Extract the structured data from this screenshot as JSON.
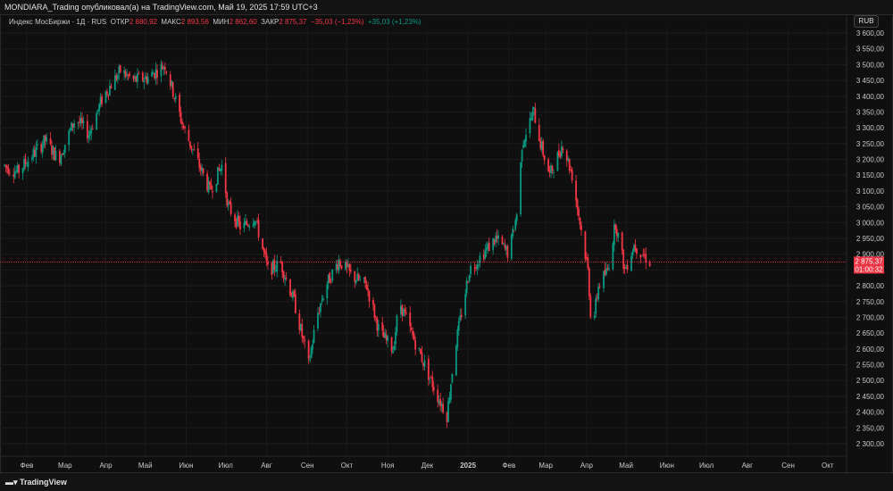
{
  "header": {
    "title": "MONDIARA_Trading опубликовал(а) на TradingView.com, Май 19, 2025 17:59 UTC+3"
  },
  "legend": {
    "symbol": "Индекс МосБиржи · 1Д · RUS",
    "open_label": "ОТКР",
    "open": "2 880,92",
    "high_label": "МАКС",
    "high": "2 893,56",
    "low_label": "МИН",
    "low": "2 862,60",
    "close_label": "ЗАКР",
    "close": "2 875,37",
    "change": "−35,03 (−1,23%)",
    "change2": "+35,03 (+1,23%)"
  },
  "currency": "RUB",
  "price_tag": {
    "price": "2 875,37",
    "countdown": "01:00:32"
  },
  "footer": {
    "brand": "TradingView"
  },
  "colors": {
    "up": "#089981",
    "down": "#f23645",
    "background": "#0f0f0f"
  },
  "chart_data": {
    "type": "candlestick",
    "title": "Индекс МосБиржи · 1Д",
    "ylim": [
      2280,
      3630
    ],
    "y_ticks": [
      3600,
      3550,
      3500,
      3450,
      3400,
      3350,
      3300,
      3250,
      3200,
      3150,
      3100,
      3050,
      3000,
      2950,
      2900,
      2850,
      2800,
      2750,
      2700,
      2650,
      2600,
      2550,
      2500,
      2450,
      2400,
      2350,
      2300
    ],
    "y_tick_labels": [
      "3 600,00",
      "3 550,00",
      "3 500,00",
      "3 450,00",
      "3 400,00",
      "3 350,00",
      "3 300,00",
      "3 250,00",
      "3 200,00",
      "3 150,00",
      "3 100,00",
      "3 050,00",
      "3 000,00",
      "2 950,00",
      "2 900,00",
      "2 850,00",
      "2 800,00",
      "2 750,00",
      "2 700,00",
      "2 650,00",
      "2 600,00",
      "2 550,00",
      "2 500,00",
      "2 450,00",
      "2 400,00",
      "2 350,00",
      "2 300,00"
    ],
    "x_ticks": [
      {
        "date": "2024-02-01",
        "label": "Фев"
      },
      {
        "date": "2024-03-01",
        "label": "Мар"
      },
      {
        "date": "2024-04-01",
        "label": "Апр"
      },
      {
        "date": "2024-05-01",
        "label": "Май"
      },
      {
        "date": "2024-06-01",
        "label": "Июн"
      },
      {
        "date": "2024-07-01",
        "label": "Июл"
      },
      {
        "date": "2024-08-01",
        "label": "Авг"
      },
      {
        "date": "2024-09-01",
        "label": "Сен"
      },
      {
        "date": "2024-10-01",
        "label": "Окт"
      },
      {
        "date": "2024-11-01",
        "label": "Ноя"
      },
      {
        "date": "2024-12-01",
        "label": "Дек"
      },
      {
        "date": "2025-01-01",
        "label": "2025"
      },
      {
        "date": "2025-02-01",
        "label": "Фев"
      },
      {
        "date": "2025-03-01",
        "label": "Мар"
      },
      {
        "date": "2025-04-01",
        "label": "Апр"
      },
      {
        "date": "2025-05-01",
        "label": "Май"
      },
      {
        "date": "2025-06-01",
        "label": "Июн"
      },
      {
        "date": "2025-07-01",
        "label": "Июл"
      },
      {
        "date": "2025-08-01",
        "label": "Авг"
      },
      {
        "date": "2025-09-01",
        "label": "Сен"
      },
      {
        "date": "2025-10-01",
        "label": "Окт"
      }
    ],
    "approx_closes": [
      [
        "2024-01-15",
        3180
      ],
      [
        "2024-01-25",
        3160
      ],
      [
        "2024-02-15",
        3260
      ],
      [
        "2024-02-25",
        3200
      ],
      [
        "2024-03-09",
        3330
      ],
      [
        "2024-03-19",
        3280
      ],
      [
        "2024-03-30",
        3400
      ],
      [
        "2024-04-12",
        3480
      ],
      [
        "2024-04-22",
        3450
      ],
      [
        "2024-05-03",
        3460
      ],
      [
        "2024-05-16",
        3500
      ],
      [
        "2024-05-23",
        3400
      ],
      [
        "2024-05-30",
        3300
      ],
      [
        "2024-06-09",
        3200
      ],
      [
        "2024-06-19",
        3100
      ],
      [
        "2024-06-28",
        3180
      ],
      [
        "2024-07-03",
        3050
      ],
      [
        "2024-07-13",
        2980
      ],
      [
        "2024-07-23",
        3020
      ],
      [
        "2024-08-02",
        2850
      ],
      [
        "2024-08-12",
        2870
      ],
      [
        "2024-08-22",
        2750
      ],
      [
        "2024-09-02",
        2550
      ],
      [
        "2024-09-08",
        2700
      ],
      [
        "2024-09-15",
        2800
      ],
      [
        "2024-09-25",
        2880
      ],
      [
        "2024-10-05",
        2830
      ],
      [
        "2024-10-16",
        2800
      ],
      [
        "2024-10-26",
        2650
      ],
      [
        "2024-11-05",
        2600
      ],
      [
        "2024-11-10",
        2750
      ],
      [
        "2024-11-19",
        2650
      ],
      [
        "2024-11-29",
        2550
      ],
      [
        "2024-12-09",
        2450
      ],
      [
        "2024-12-16",
        2390
      ],
      [
        "2024-12-22",
        2600
      ],
      [
        "2025-01-02",
        2850
      ],
      [
        "2025-01-12",
        2900
      ],
      [
        "2025-01-22",
        2950
      ],
      [
        "2025-02-01",
        2900
      ],
      [
        "2025-02-08",
        3050
      ],
      [
        "2025-02-11",
        3250
      ],
      [
        "2025-02-15",
        3300
      ],
      [
        "2025-02-20",
        3350
      ],
      [
        "2025-02-25",
        3250
      ],
      [
        "2025-03-04",
        3150
      ],
      [
        "2025-03-14",
        3250
      ],
      [
        "2025-03-21",
        3150
      ],
      [
        "2025-03-27",
        3000
      ],
      [
        "2025-04-02",
        2850
      ],
      [
        "2025-04-05",
        2650
      ],
      [
        "2025-04-10",
        2800
      ],
      [
        "2025-04-17",
        2850
      ],
      [
        "2025-04-23",
        3000
      ],
      [
        "2025-04-30",
        2850
      ],
      [
        "2025-05-07",
        2930
      ],
      [
        "2025-05-19",
        2875.37
      ]
    ],
    "last_price": 2875.37
  }
}
